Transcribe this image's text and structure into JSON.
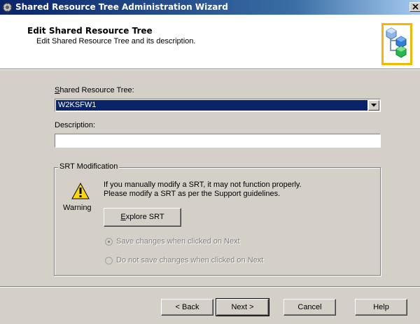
{
  "window": {
    "title": "Shared Resource Tree Administration Wizard",
    "close_label": "X"
  },
  "header": {
    "title": "Edit Shared Resource Tree",
    "subtitle": "Edit Shared Resource Tree and its description."
  },
  "form": {
    "srt_label": "Shared Resource Tree:",
    "srt_value": "W2KSFW1",
    "description_label": "Description:",
    "description_value": ""
  },
  "srt_modification": {
    "legend": "SRT Modification",
    "message_line1": "If you manually modify a SRT, it may not function properly.",
    "message_line2": "Please modify a SRT as per the Support guidelines.",
    "warning_caption": "Warning",
    "explore_button": "Explore SRT",
    "radio_save": "Save changes when clicked on Next",
    "radio_dont_save": "Do not save changes when clicked on Next",
    "selected": "save"
  },
  "footer": {
    "back": "< Back",
    "next": "Next >",
    "cancel": "Cancel",
    "help": "Help"
  },
  "colors": {
    "titlebar_start": "#0a246a",
    "selection": "#0a246a",
    "logo_border": "#f5b800",
    "dialog_face": "#d4d0c8"
  }
}
